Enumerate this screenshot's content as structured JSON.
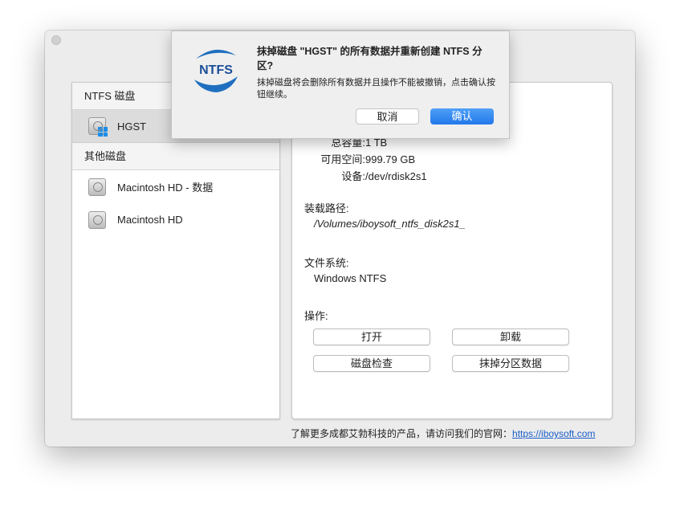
{
  "sidebar": {
    "ntfs_header": "NTFS 磁盘",
    "ntfs_disks": [
      {
        "name": "HGST"
      }
    ],
    "other_header": "其他磁盘",
    "other_disks": [
      {
        "name": "Macintosh HD - 数据"
      },
      {
        "name": "Macintosh HD"
      }
    ]
  },
  "details": {
    "capacity_label": "总容量:",
    "capacity_value": "1 TB",
    "free_label": "可用空间:",
    "free_value": "999.79 GB",
    "device_label": "设备:",
    "device_value": "/dev/rdisk2s1",
    "mount_label": "装载路径:",
    "mount_value": "/Volumes/iboysoft_ntfs_disk2s1_",
    "fs_label": "文件系统:",
    "fs_value": "Windows NTFS",
    "actions_label": "操作:",
    "actions": {
      "open": "打开",
      "unmount": "卸载",
      "check": "磁盘检查",
      "erase": "抹掉分区数据"
    }
  },
  "footer": {
    "text": "了解更多成都艾勃科技的产品，请访问我们的官网：",
    "link": "https://iboysoft.com"
  },
  "dialog": {
    "logo_text": "NTFS",
    "title": "抹掉磁盘 \"HGST\" 的所有数据并重新创建 NTFS 分区?",
    "message": "抹掉磁盘将会删除所有数据并且操作不能被撤销，点击确认按钮继续。",
    "cancel": "取消",
    "confirm": "确认"
  },
  "colors": {
    "accent": "#2f86ef",
    "link": "#1a5dc8"
  }
}
